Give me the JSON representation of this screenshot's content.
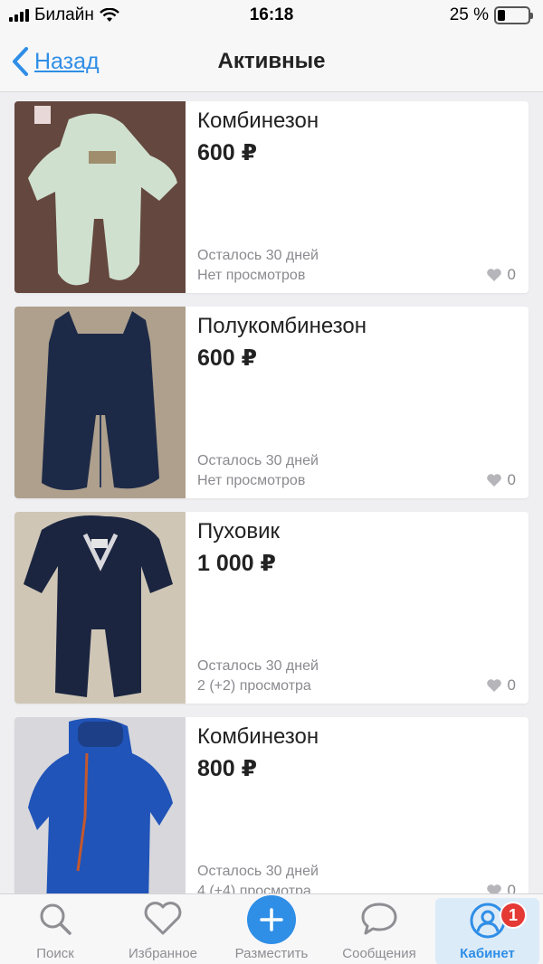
{
  "status_bar": {
    "carrier": "Билайн",
    "time": "16:18",
    "battery": "25 %",
    "battery_level": 0.25
  },
  "nav": {
    "back_label": "Назад",
    "title": "Активные"
  },
  "listings": [
    {
      "title": "Комбинезон",
      "price": "600 ₽",
      "days_left": "Осталось 30 дней",
      "views": "Нет просмотров",
      "likes": "0"
    },
    {
      "title": "Полукомбинезон",
      "price": "600 ₽",
      "days_left": "Осталось 30 дней",
      "views": "Нет просмотров",
      "likes": "0"
    },
    {
      "title": "Пуховик",
      "price": "1 000 ₽",
      "days_left": "Осталось 30 дней",
      "views": "2 (+2) просмотра",
      "likes": "0"
    },
    {
      "title": "Комбинезон",
      "price": "800 ₽",
      "days_left": "Осталось 30 дней",
      "views": "4 (+4) просмотра",
      "likes": "0"
    }
  ],
  "tabbar": {
    "search": "Поиск",
    "favorites": "Избранное",
    "post": "Разместить",
    "messages": "Сообщения",
    "cabinet": "Кабинет",
    "cabinet_badge": "1"
  },
  "colors": {
    "accent": "#2f8ee6",
    "badge": "#e53935",
    "muted_text": "#8a8a8f"
  }
}
